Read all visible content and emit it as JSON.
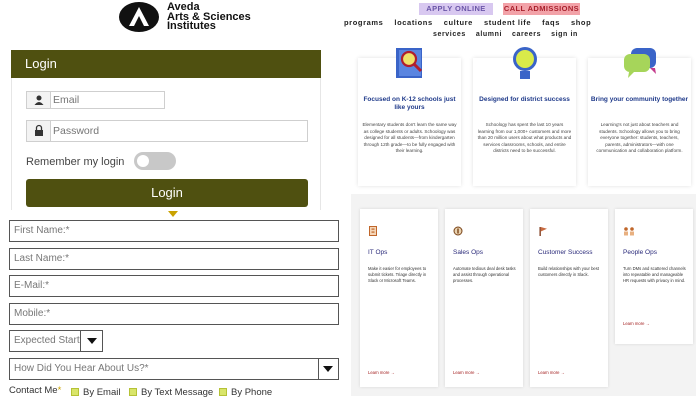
{
  "header": {
    "brand_line1": "Aveda",
    "brand_line2": "Arts & Sciences",
    "brand_line3": "Institutes",
    "apply_label": "APPLY ONLINE",
    "call_label": "CALL ADMISSIONS",
    "nav_primary": [
      "programs",
      "locations",
      "culture",
      "student life",
      "faqs",
      "shop"
    ],
    "nav_secondary": [
      "services",
      "alumni",
      "careers",
      "sign in"
    ]
  },
  "login": {
    "title": "Login",
    "email_placeholder": "Email",
    "password_placeholder": "Password",
    "remember_label": "Remember my login",
    "remember_on": false,
    "submit_label": "Login"
  },
  "form": {
    "first_name": "First Name:*",
    "last_name": "Last Name:*",
    "email": "E-Mail:*",
    "mobile": "Mobile:*",
    "start": "Expected Start Y",
    "hear": "How Did You Hear About Us?*",
    "contact_label": "Contact Me",
    "contact_star": "*",
    "contact_options": [
      "By Email",
      "By Text Message",
      "By Phone"
    ]
  },
  "features": [
    {
      "icon": "magnifier-on-book-icon",
      "title": "Focused on K-12 schools just like yours",
      "body": "Elementary students don't learn the same way as college students or adults. Schoology was designed for all students—from kindergarten through 12th grade—to be fully engaged with their learning."
    },
    {
      "icon": "lightbulb-icon",
      "title": "Designed for district success",
      "body": "Schoology has spent the last 10 years learning from our 1,000+ customers and more than 20 million users about what products and services classrooms, schools, and entire districts need to be successful."
    },
    {
      "icon": "chat-bubbles-icon",
      "title": "Bring your community together",
      "body": "Learning's not just about teachers and students. Schoology allows you to bring everyone together: students, teachers, parents, administrators—with one communication and collaboration platform."
    }
  ],
  "ops": [
    {
      "icon": "building-icon",
      "title": "IT Ops",
      "body": "Make it easier for employees to submit tickets. Triage directly in Slack or Microsoft Teams.",
      "link": "Learn more →"
    },
    {
      "icon": "coin-icon",
      "title": "Sales Ops",
      "body": "Automate tedious deal desk tasks and assist through operational processes.",
      "link": "Learn more →"
    },
    {
      "icon": "flag-icon",
      "title": "Customer Success",
      "body": "Build relationships with your best customers directly in Slack.",
      "link": "Learn more →"
    },
    {
      "icon": "people-icon",
      "title": "People Ops",
      "body": "Turn DMs and scattered channels into repeatable and manageable HR requests with privacy in mind.",
      "link": "Learn more →"
    }
  ],
  "colors": {
    "olive": "#4f5010",
    "apply_bg": "#d8c8f0",
    "call_bg": "#f2a2a8",
    "feature_title": "#1f3a8a",
    "link_red": "#a01818"
  }
}
